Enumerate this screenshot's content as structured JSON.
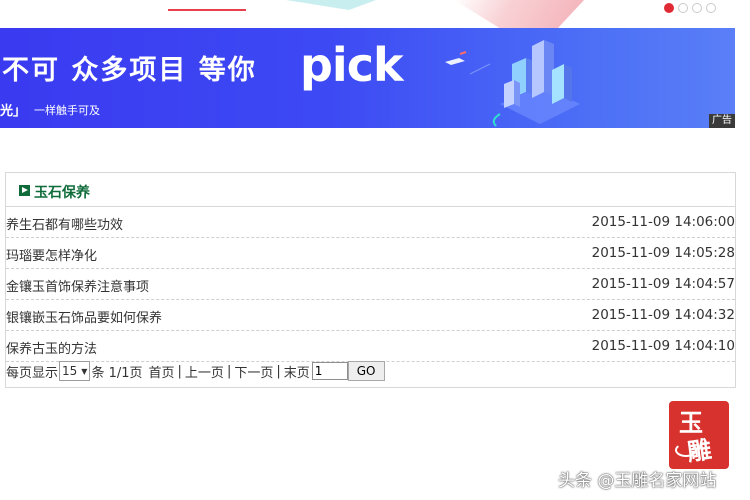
{
  "banner": {
    "headline": "不可 众多项目 等你",
    "brand": "pick",
    "sub_left": "光」",
    "sub": "一样触手可及",
    "ad_label": "广告"
  },
  "carousel": {
    "dots": 4,
    "active_index": 0
  },
  "section": {
    "title": "玉石保养",
    "rows": [
      {
        "title": "养生石都有哪些功效",
        "time": "2015-11-09 14:06:00"
      },
      {
        "title": "玛瑙要怎样净化",
        "time": "2015-11-09 14:05:28"
      },
      {
        "title": "金镶玉首饰保养注意事项",
        "time": "2015-11-09 14:04:57"
      },
      {
        "title": "银镶嵌玉石饰品要如何保养",
        "time": "2015-11-09 14:04:32"
      },
      {
        "title": "保养古玉的方法",
        "time": "2015-11-09 14:04:10"
      }
    ]
  },
  "pager": {
    "per_page_label": "每页显示",
    "per_page_value": "15",
    "summary": "条 1/1页",
    "first": "首页",
    "prev": "上一页",
    "next": "下一页",
    "last": "末页",
    "page_input_value": "1",
    "go": "GO"
  },
  "watermark": {
    "seal_chars": [
      "玉",
      "雕"
    ],
    "text": "头条 @玉雕名家网站"
  }
}
